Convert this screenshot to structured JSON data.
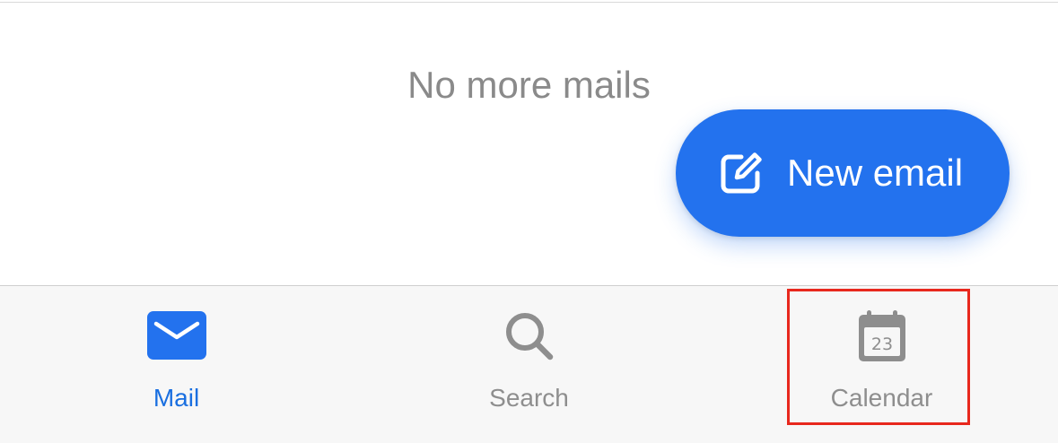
{
  "content": {
    "empty_message": "No more mails"
  },
  "fab": {
    "label": "New email",
    "icon": "compose-icon",
    "color": "#2372ee"
  },
  "tabbar": {
    "tabs": [
      {
        "label": "Mail",
        "icon": "mail-icon",
        "selected": true
      },
      {
        "label": "Search",
        "icon": "search-icon",
        "selected": false
      },
      {
        "label": "Calendar",
        "icon": "calendar-icon",
        "icon_text": "23",
        "selected": false
      }
    ],
    "active_color": "#1a6fe0",
    "inactive_color": "#8e8e8e"
  },
  "annotation": {
    "highlight_target": "tab-calendar",
    "highlight_color": "#e8281d"
  }
}
